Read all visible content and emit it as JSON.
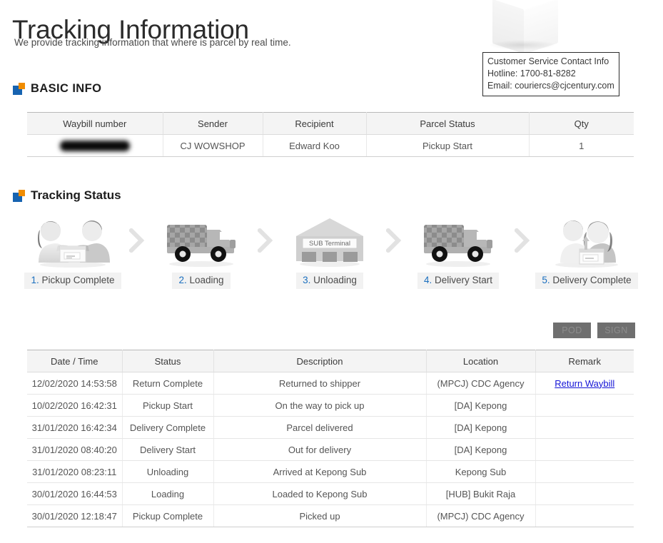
{
  "header": {
    "title": "Tracking Information",
    "subtitle": "We provide tracking information that where is parcel by real time."
  },
  "contact": {
    "title": "Customer Service Contact Info",
    "hotline": "Hotline: 1700-81-8282",
    "email": "Email: couriercs@cjcentury.com"
  },
  "sections": {
    "basic_info_title": "BASIC INFO",
    "tracking_status_title": "Tracking Status"
  },
  "basic_info": {
    "columns": [
      "Waybill number",
      "Sender",
      "Recipient",
      "Parcel Status",
      "Qty"
    ],
    "row": {
      "waybill_number": "",
      "sender": "CJ WOWSHOP",
      "recipient": "Edward Koo",
      "parcel_status": "Pickup Start",
      "qty": "1"
    }
  },
  "steps": [
    {
      "num": "1.",
      "label": " Pickup Complete",
      "icon": "people-handover-icon"
    },
    {
      "num": "2.",
      "label": " Loading",
      "icon": "truck-icon"
    },
    {
      "num": "3.",
      "label": " Unloading",
      "icon": "terminal-icon",
      "terminal_label": "SUB Terminal"
    },
    {
      "num": "4.",
      "label": " Delivery Start",
      "icon": "truck-icon"
    },
    {
      "num": "5.",
      "label": " Delivery Complete",
      "icon": "people-delivery-icon"
    }
  ],
  "buttons": {
    "pod": "POD",
    "sign": "SIGN"
  },
  "history": {
    "columns": [
      "Date / Time",
      "Status",
      "Description",
      "Location",
      "Remark"
    ],
    "rows": [
      {
        "datetime": "12/02/2020 14:53:58",
        "status": "Return Complete",
        "description": "Returned to shipper",
        "location": "(MPCJ) CDC Agency",
        "remark": "Return Waybill"
      },
      {
        "datetime": "10/02/2020 16:42:31",
        "status": "Pickup Start",
        "description": "On the way to pick up",
        "location": "[DA] Kepong",
        "remark": ""
      },
      {
        "datetime": "31/01/2020 16:42:34",
        "status": "Delivery Complete",
        "description": "Parcel delivered",
        "location": "[DA] Kepong",
        "remark": ""
      },
      {
        "datetime": "31/01/2020 08:40:20",
        "status": "Delivery Start",
        "description": "Out for delivery",
        "location": "[DA] Kepong",
        "remark": ""
      },
      {
        "datetime": "31/01/2020 08:23:11",
        "status": "Unloading",
        "description": "Arrived at Kepong Sub",
        "location": "Kepong Sub",
        "remark": ""
      },
      {
        "datetime": "30/01/2020 16:44:53",
        "status": "Loading",
        "description": "Loaded to Kepong Sub",
        "location": "[HUB] Bukit Raja",
        "remark": ""
      },
      {
        "datetime": "30/01/2020 12:18:47",
        "status": "Pickup Complete",
        "description": "Picked up",
        "location": "(MPCJ) CDC Agency",
        "remark": ""
      }
    ]
  },
  "colors": {
    "accent_blue": "#1763b0",
    "accent_orange": "#f08c00",
    "link_blue": "#1414d6",
    "step_num_blue": "#1b6fbf"
  }
}
